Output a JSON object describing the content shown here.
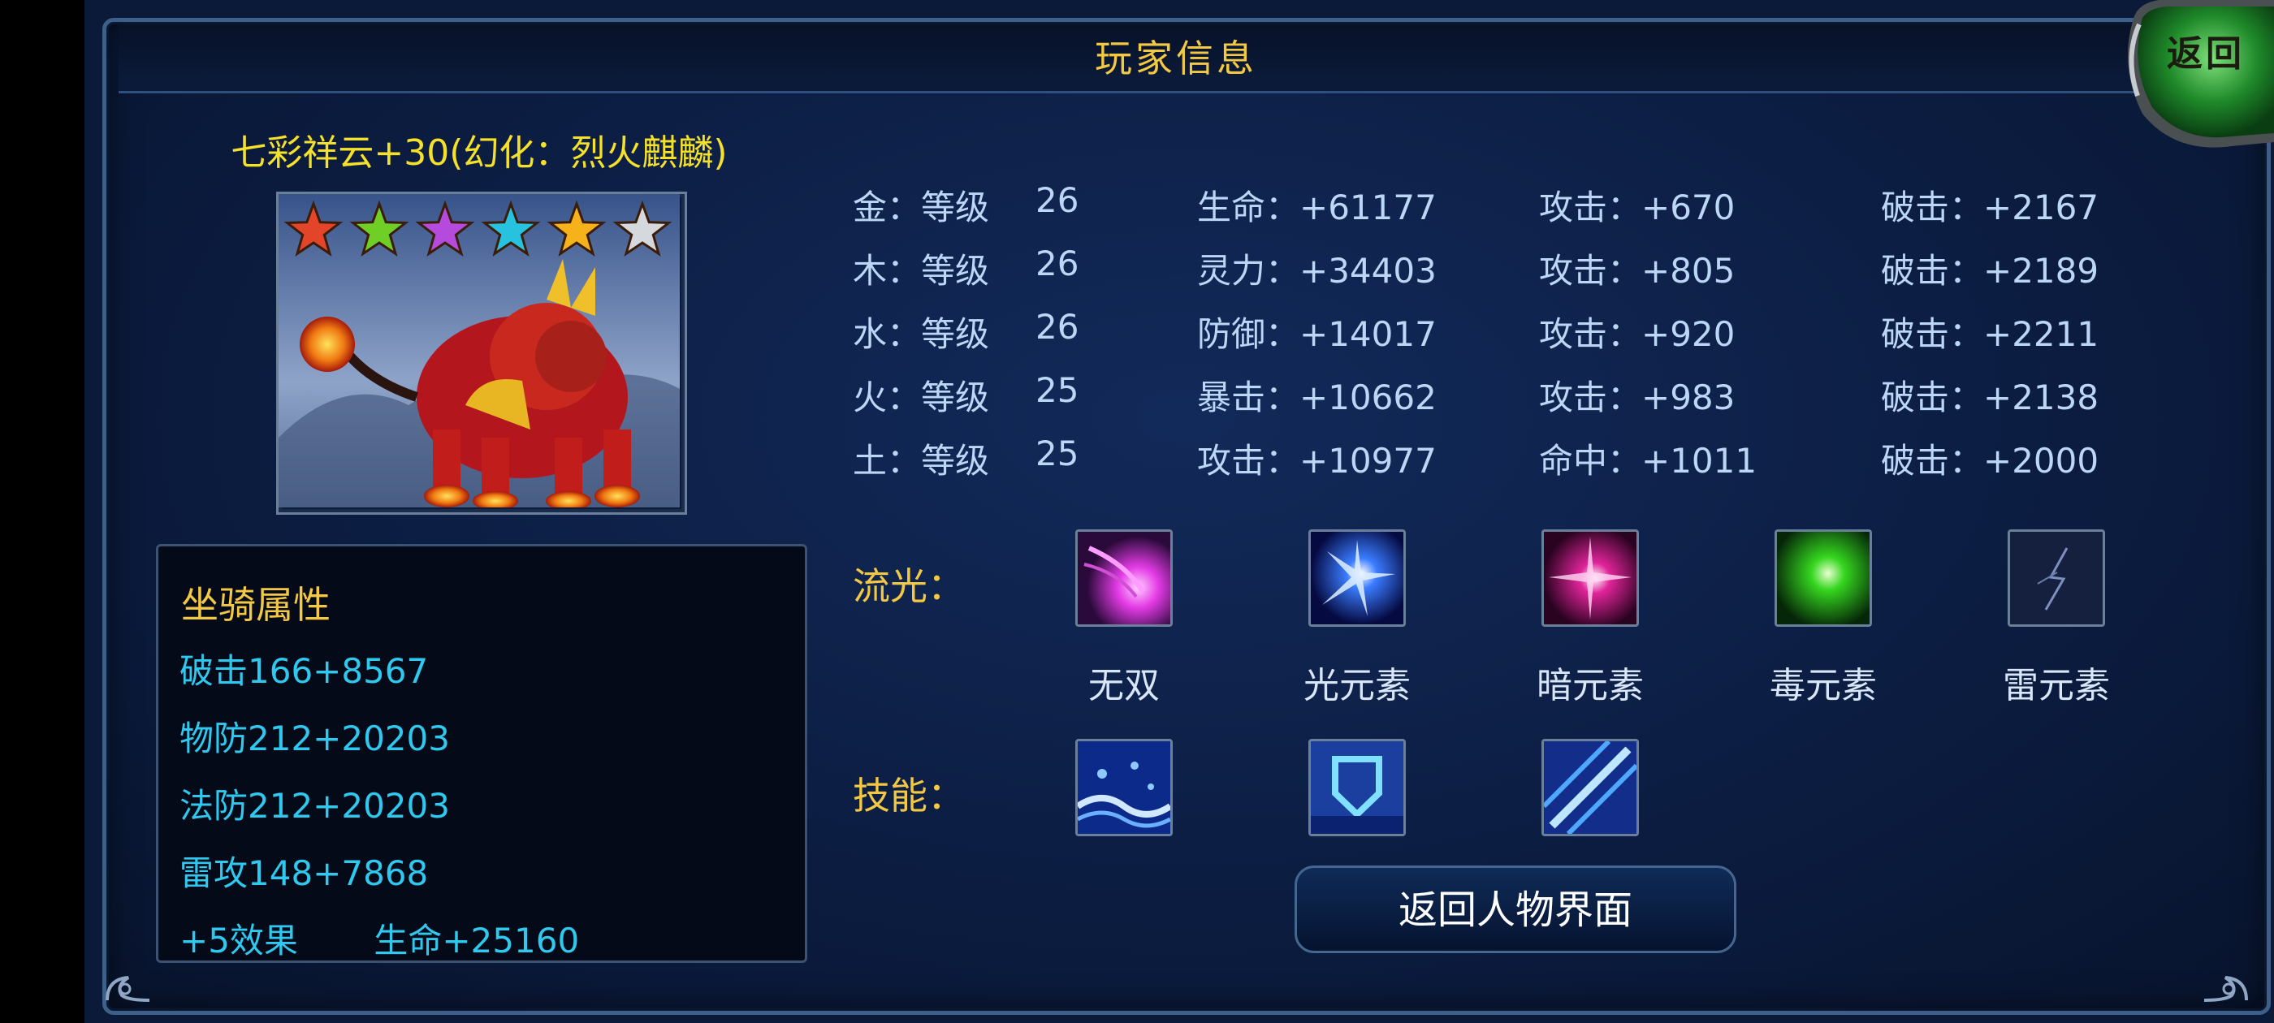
{
  "header": {
    "title": "玩家信息",
    "back_icon_label": "返回"
  },
  "mount": {
    "name": "七彩祥云+30(幻化：烈火麒麟)",
    "stars": [
      {
        "color": "#e2452a"
      },
      {
        "color": "#6fcf27"
      },
      {
        "color": "#b54bdc"
      },
      {
        "color": "#26c2e0"
      },
      {
        "color": "#f5b21a"
      },
      {
        "color": "#d5d8dc"
      }
    ]
  },
  "attributes": {
    "title": "坐骑属性",
    "lines": [
      "破击166+8567",
      "物防212+20203",
      "法防212+20203",
      "雷攻148+7868",
      "+5效果       生命+25160"
    ]
  },
  "stats": {
    "rows": [
      {
        "element": "金：等级",
        "level": "26",
        "c2": "生命：+61177",
        "c3": "攻击：+670",
        "c4": "破击：+2167"
      },
      {
        "element": "木：等级",
        "level": "26",
        "c2": "灵力：+34403",
        "c3": "攻击：+805",
        "c4": "破击：+2189"
      },
      {
        "element": "水：等级",
        "level": "26",
        "c2": "防御：+14017",
        "c3": "攻击：+920",
        "c4": "破击：+2211"
      },
      {
        "element": "火：等级",
        "level": "25",
        "c2": "暴击：+10662",
        "c3": "攻击：+983",
        "c4": "破击：+2138"
      },
      {
        "element": "土：等级",
        "level": "25",
        "c2": "攻击：+10977",
        "c3": "命中：+1011",
        "c4": "破击：+2000"
      }
    ]
  },
  "flow": {
    "label": "流光：",
    "items": [
      {
        "name": "无双",
        "icon": "pink-comet-icon"
      },
      {
        "name": "光元素",
        "icon": "blue-burst-icon"
      },
      {
        "name": "暗元素",
        "icon": "magenta-burst-icon"
      },
      {
        "name": "毒元素",
        "icon": "green-burst-icon"
      },
      {
        "name": "雷元素",
        "icon": "lightning-icon"
      }
    ]
  },
  "skills": {
    "label": "技能：",
    "items": [
      {
        "icon": "water-wave-icon"
      },
      {
        "icon": "shield-icon"
      },
      {
        "icon": "blue-slash-icon"
      }
    ]
  },
  "return_button": {
    "label": "返回人物界面"
  }
}
